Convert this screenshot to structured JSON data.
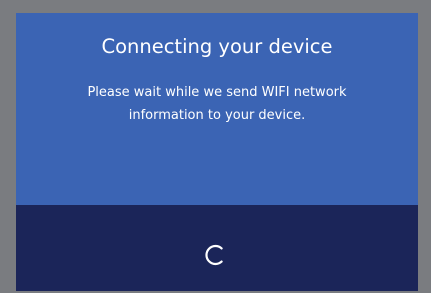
{
  "dialog": {
    "title": "Connecting your device",
    "message": "Please wait while we send WIFI network information to your device.",
    "spinner_icon": "loading-spinner-icon"
  },
  "colors": {
    "background": "#7a7c80",
    "top_panel": "#3b64b4",
    "bottom_panel": "#1b2559",
    "text": "#ffffff"
  }
}
